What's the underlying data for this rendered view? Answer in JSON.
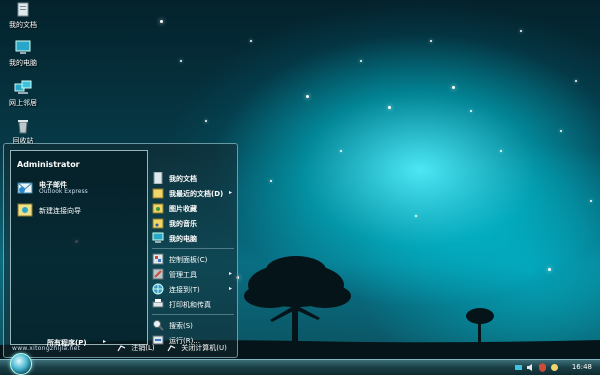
{
  "desktop": {
    "icons": [
      {
        "label": "我的文档",
        "icon": "my-documents-icon"
      },
      {
        "label": "我的电脑",
        "icon": "my-computer-icon"
      },
      {
        "label": "网上邻居",
        "icon": "network-places-icon"
      },
      {
        "label": "回收站",
        "icon": "recycle-bin-icon"
      }
    ]
  },
  "start_menu": {
    "user_name": "Administrator",
    "pinned": [
      {
        "title": "电子邮件",
        "subtitle": "Outlook Express",
        "icon": "email-icon"
      },
      {
        "title": "新建连接向导",
        "icon": "connection-wizard-icon"
      }
    ],
    "all_programs": "所有程序(P)",
    "all_programs_arrow": "▸",
    "right_items": [
      {
        "label": "我的文档",
        "icon": "my-documents-icon",
        "bold": true
      },
      {
        "label": "我最近的文档(D)",
        "icon": "recent-documents-icon",
        "bold": true,
        "arrow": "▸"
      },
      {
        "label": "图片收藏",
        "icon": "my-pictures-icon",
        "bold": true
      },
      {
        "label": "我的音乐",
        "icon": "my-music-icon",
        "bold": true
      },
      {
        "label": "我的电脑",
        "icon": "my-computer-icon",
        "bold": true
      },
      {
        "label": "控制面板(C)",
        "icon": "control-panel-icon"
      },
      {
        "label": "管理工具",
        "icon": "admin-tools-icon",
        "arrow": "▸"
      },
      {
        "label": "连接到(T)",
        "icon": "connect-to-icon",
        "arrow": "▸"
      },
      {
        "label": "打印机和传真",
        "icon": "printers-faxes-icon"
      },
      {
        "label": "搜索(S)",
        "icon": "search-icon"
      },
      {
        "label": "运行(R)...",
        "icon": "run-icon"
      }
    ],
    "footer": {
      "watermark": "www.xitongzhijia.net",
      "logoff": "注销(L)",
      "shutdown": "关闭计算机(U)"
    }
  },
  "taskbar": {
    "clock": "16:48",
    "tray_icons": [
      "network-tray-icon",
      "volume-tray-icon",
      "security-tray-icon",
      "update-tray-icon"
    ]
  },
  "colors": {
    "sky_glow": "#50f0ff",
    "sky_dark": "#04222c",
    "menu_border": "#aadce6",
    "taskbar": "#1a3e45"
  }
}
